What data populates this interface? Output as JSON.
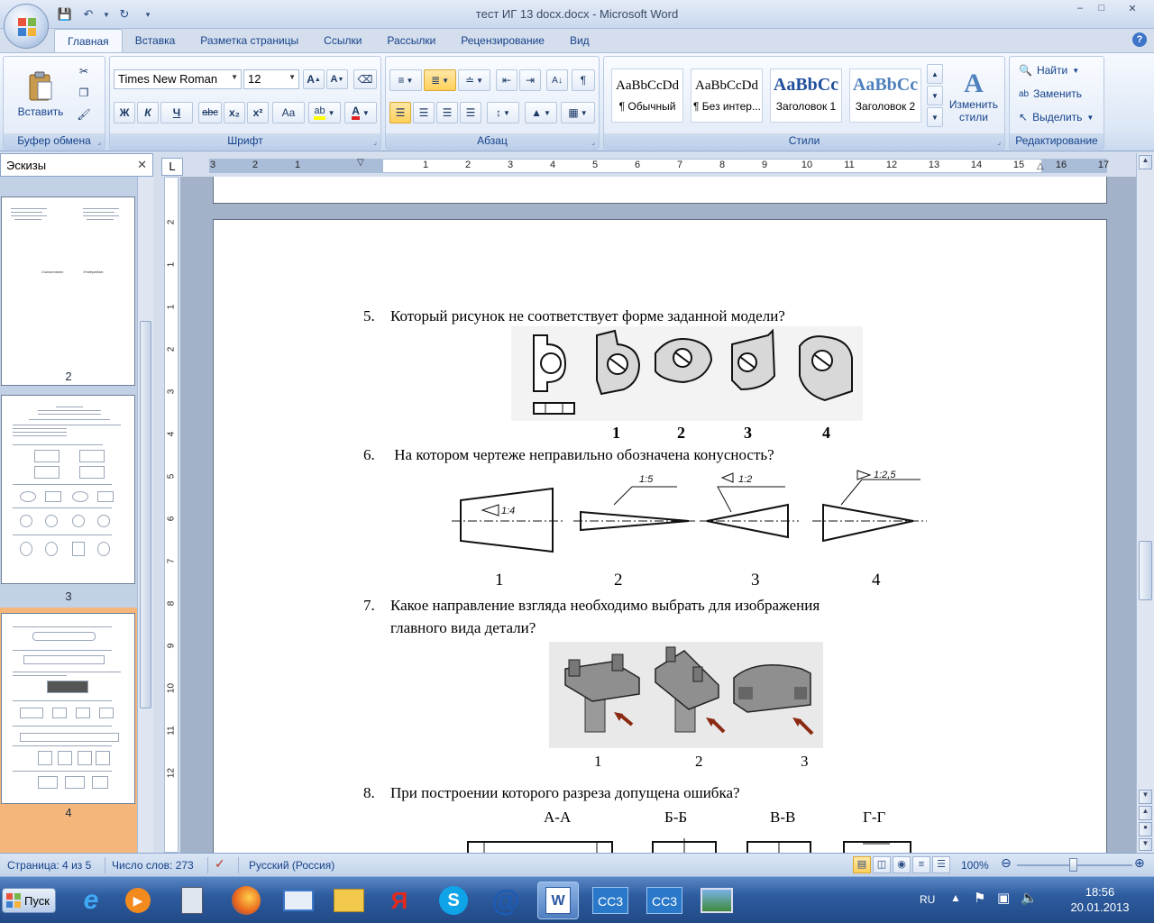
{
  "window": {
    "title": "тест ИГ 13 docx.docx - Microsoft Word",
    "minimize": "–",
    "maximize": "□",
    "close": "✕"
  },
  "ribbon": {
    "tabs": [
      "Главная",
      "Вставка",
      "Разметка страницы",
      "Ссылки",
      "Рассылки",
      "Рецензирование",
      "Вид"
    ],
    "clipboard": {
      "label": "Буфер обмена",
      "paste_label": "Вставить"
    },
    "font": {
      "label": "Шрифт",
      "family": "Times New Roman",
      "size": "12",
      "bold": "Ж",
      "italic": "К",
      "underline": "Ч",
      "strike": "abc",
      "sub": "x₂",
      "sup": "x²",
      "case": "Aa"
    },
    "paragraph": {
      "label": "Абзац"
    },
    "styles": {
      "label": "Стили",
      "items": [
        {
          "sample": "AaBbCcDd",
          "name": "¶ Обычный"
        },
        {
          "sample": "AaBbCcDd",
          "name": "¶ Без интер..."
        },
        {
          "sample": "AaBbCc",
          "name": "Заголовок 1"
        },
        {
          "sample": "AaBbCc",
          "name": "Заголовок 2"
        }
      ],
      "change_label_1": "Изменить",
      "change_label_2": "стили"
    },
    "editing": {
      "label": "Редактирование",
      "find": "Найти",
      "replace": "Заменить",
      "select": "Выделить"
    }
  },
  "nav": {
    "title": "Эскизы",
    "pages": [
      "2",
      "3",
      "4"
    ],
    "thumb2": {
      "left_text": "Согласовано",
      "right_text": "Утверждаю"
    }
  },
  "ruler": {
    "h": [
      "3",
      "2",
      "1",
      "1",
      "2",
      "3",
      "4",
      "5",
      "6",
      "7",
      "8",
      "9",
      "10",
      "11",
      "12",
      "13",
      "14",
      "15",
      "16",
      "17"
    ],
    "v": [
      "2",
      "1",
      "1",
      "2",
      "3",
      "4",
      "5",
      "6",
      "7",
      "8",
      "9",
      "10",
      "11",
      "12"
    ],
    "corner": "L"
  },
  "document": {
    "q5": {
      "num": "5.",
      "text": "Который  рисунок не соответствует форме заданной модели?",
      "labels": [
        "1",
        "2",
        "3",
        "4"
      ]
    },
    "q6": {
      "num": "6.",
      "text": " На котором чертеже неправильно обозначена конусность?",
      "labels": [
        "1",
        "2",
        "3",
        "4"
      ],
      "tapers": [
        "1:4",
        "1:5",
        "1:2",
        "1:2,5"
      ]
    },
    "q7": {
      "num": "7.",
      "line1": "Какое направление взгляда необходимо выбрать для изображения",
      "line2": "главного вида детали?",
      "labels": [
        "1",
        "2",
        "3"
      ]
    },
    "q8": {
      "num": "8.",
      "text": "При построении  которого разреза допущена ошибка?",
      "sections": [
        "А-А",
        "Б-Б",
        "В-В",
        "Г-Г"
      ]
    }
  },
  "status": {
    "page": "Страница: 4 из 5",
    "words": "Число слов: 273",
    "lang": "Русский (Россия)",
    "zoom": "100%",
    "zoom_level": 1.0
  },
  "taskbar": {
    "start": "Пуск",
    "cc3_a": "CC3",
    "cc3_b": "CC3",
    "yandex": "Я",
    "lang": "RU",
    "time": "18:56",
    "date": "20.01.2013"
  }
}
